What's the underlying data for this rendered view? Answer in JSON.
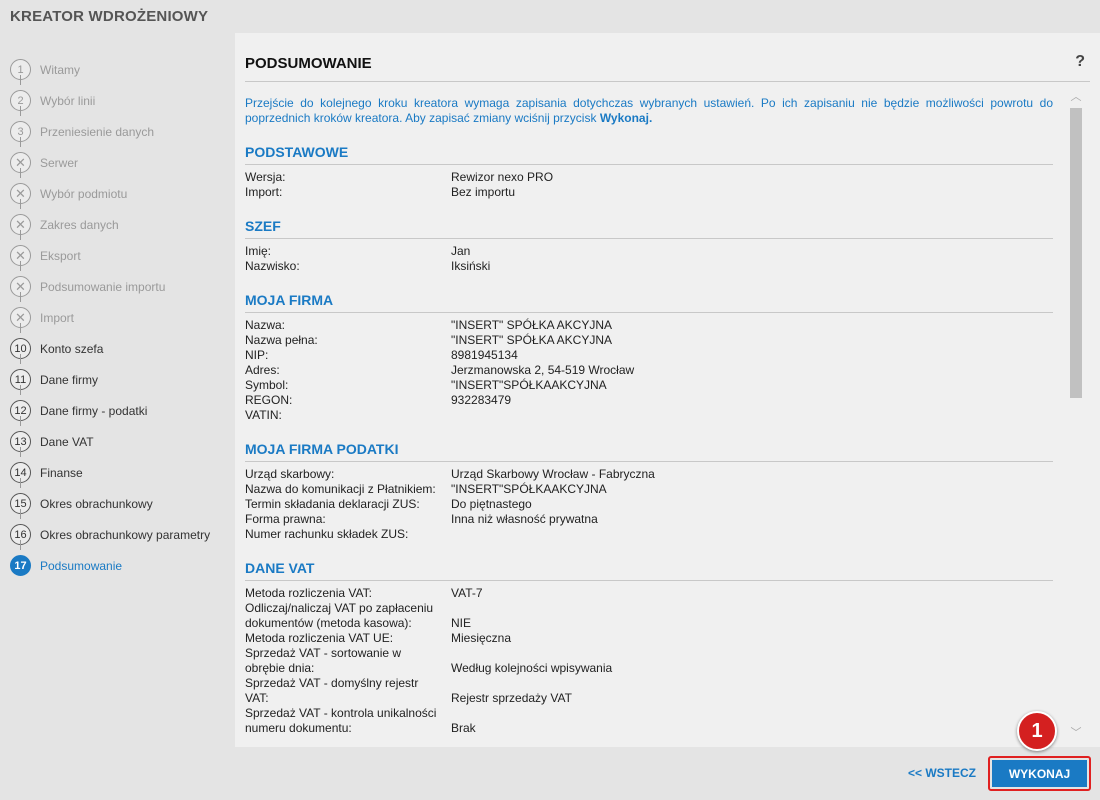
{
  "app": {
    "title": "KREATOR WDROŻENIOWY"
  },
  "steps": [
    {
      "num": "1",
      "label": "Witamy",
      "state": "done"
    },
    {
      "num": "2",
      "label": "Wybór linii",
      "state": "done"
    },
    {
      "num": "3",
      "label": "Przeniesienie danych",
      "state": "done"
    },
    {
      "num": "✕",
      "label": "Serwer",
      "state": "skipped"
    },
    {
      "num": "✕",
      "label": "Wybór podmiotu",
      "state": "skipped"
    },
    {
      "num": "✕",
      "label": "Zakres danych",
      "state": "skipped"
    },
    {
      "num": "✕",
      "label": "Eksport",
      "state": "skipped"
    },
    {
      "num": "✕",
      "label": "Podsumowanie importu",
      "state": "skipped"
    },
    {
      "num": "✕",
      "label": "Import",
      "state": "skipped"
    },
    {
      "num": "10",
      "label": "Konto szefa",
      "state": "active-done"
    },
    {
      "num": "11",
      "label": "Dane firmy",
      "state": "active-done"
    },
    {
      "num": "12",
      "label": "Dane firmy - podatki",
      "state": "active-done"
    },
    {
      "num": "13",
      "label": "Dane VAT",
      "state": "active-done"
    },
    {
      "num": "14",
      "label": "Finanse",
      "state": "active-done"
    },
    {
      "num": "15",
      "label": "Okres obrachunkowy",
      "state": "active-done"
    },
    {
      "num": "16",
      "label": "Okres obrachunkowy parametry",
      "state": "active-done"
    },
    {
      "num": "17",
      "label": "Podsumowanie",
      "state": "current"
    }
  ],
  "panel": {
    "title": "PODSUMOWANIE",
    "help": "?",
    "intro_text": "Przejście do kolejnego kroku kreatora wymaga zapisania dotychczas wybranych ustawień. Po ich zapisaniu nie będzie możliwości powrotu do poprzednich kroków kreatora. Aby zapisać zmiany wciśnij przycisk ",
    "intro_bold": "Wykonaj."
  },
  "sections": [
    {
      "title": "PODSTAWOWE",
      "rows": [
        {
          "k": "Wersja:",
          "v": "Rewizor nexo PRO"
        },
        {
          "k": "Import:",
          "v": "Bez importu"
        }
      ]
    },
    {
      "title": "SZEF",
      "rows": [
        {
          "k": "Imię:",
          "v": "Jan"
        },
        {
          "k": "Nazwisko:",
          "v": "Iksiński"
        }
      ]
    },
    {
      "title": "MOJA FIRMA",
      "rows": [
        {
          "k": "Nazwa:",
          "v": "\"INSERT\" SPÓŁKA AKCYJNA"
        },
        {
          "k": "Nazwa pełna:",
          "v": "\"INSERT\" SPÓŁKA AKCYJNA"
        },
        {
          "k": "NIP:",
          "v": "8981945134"
        },
        {
          "k": "Adres:",
          "v": "Jerzmanowska 2, 54-519 Wrocław"
        },
        {
          "k": "Symbol:",
          "v": "\"INSERT\"SPÓŁKAAKCYJNA"
        },
        {
          "k": "REGON:",
          "v": "932283479"
        },
        {
          "k": "VATIN:",
          "v": ""
        }
      ]
    },
    {
      "title": "MOJA FIRMA PODATKI",
      "rows": [
        {
          "k": "Urząd skarbowy:",
          "v": "Urząd Skarbowy Wrocław - Fabryczna"
        },
        {
          "k": "Nazwa do komunikacji z Płatnikiem:",
          "v": "\"INSERT\"SPÓŁKAAKCYJNA"
        },
        {
          "k": "Termin składania deklaracji ZUS:",
          "v": "Do piętnastego"
        },
        {
          "k": "Forma prawna:",
          "v": "Inna niż własność prywatna"
        },
        {
          "k": "Numer rachunku składek ZUS:",
          "v": ""
        }
      ]
    },
    {
      "title": "DANE VAT",
      "rows": [
        {
          "k": "Metoda rozliczenia VAT:",
          "v": "VAT-7"
        },
        {
          "k": "Odliczaj/naliczaj VAT po zapłaceniu",
          "v": ""
        },
        {
          "k": "dokumentów (metoda kasowa):",
          "v": "NIE"
        },
        {
          "k": "Metoda rozliczenia VAT UE:",
          "v": "Miesięczna"
        },
        {
          "k": "Sprzedaż VAT - sortowanie w",
          "v": ""
        },
        {
          "k": "obrębie dnia:",
          "v": "Według kolejności wpisywania"
        },
        {
          "k": "Sprzedaż VAT - domyślny rejestr",
          "v": ""
        },
        {
          "k": "VAT:",
          "v": "Rejestr sprzedaży VAT"
        },
        {
          "k": "Sprzedaż VAT - kontrola unikalności",
          "v": ""
        },
        {
          "k": "numeru dokumentu:",
          "v": "Brak"
        }
      ]
    }
  ],
  "footer": {
    "back_label": "<< WSTECZ",
    "execute_label": "WYKONAJ",
    "badge": "1"
  },
  "colors": {
    "accent": "#1a7ac4",
    "highlight": "#e02020"
  }
}
